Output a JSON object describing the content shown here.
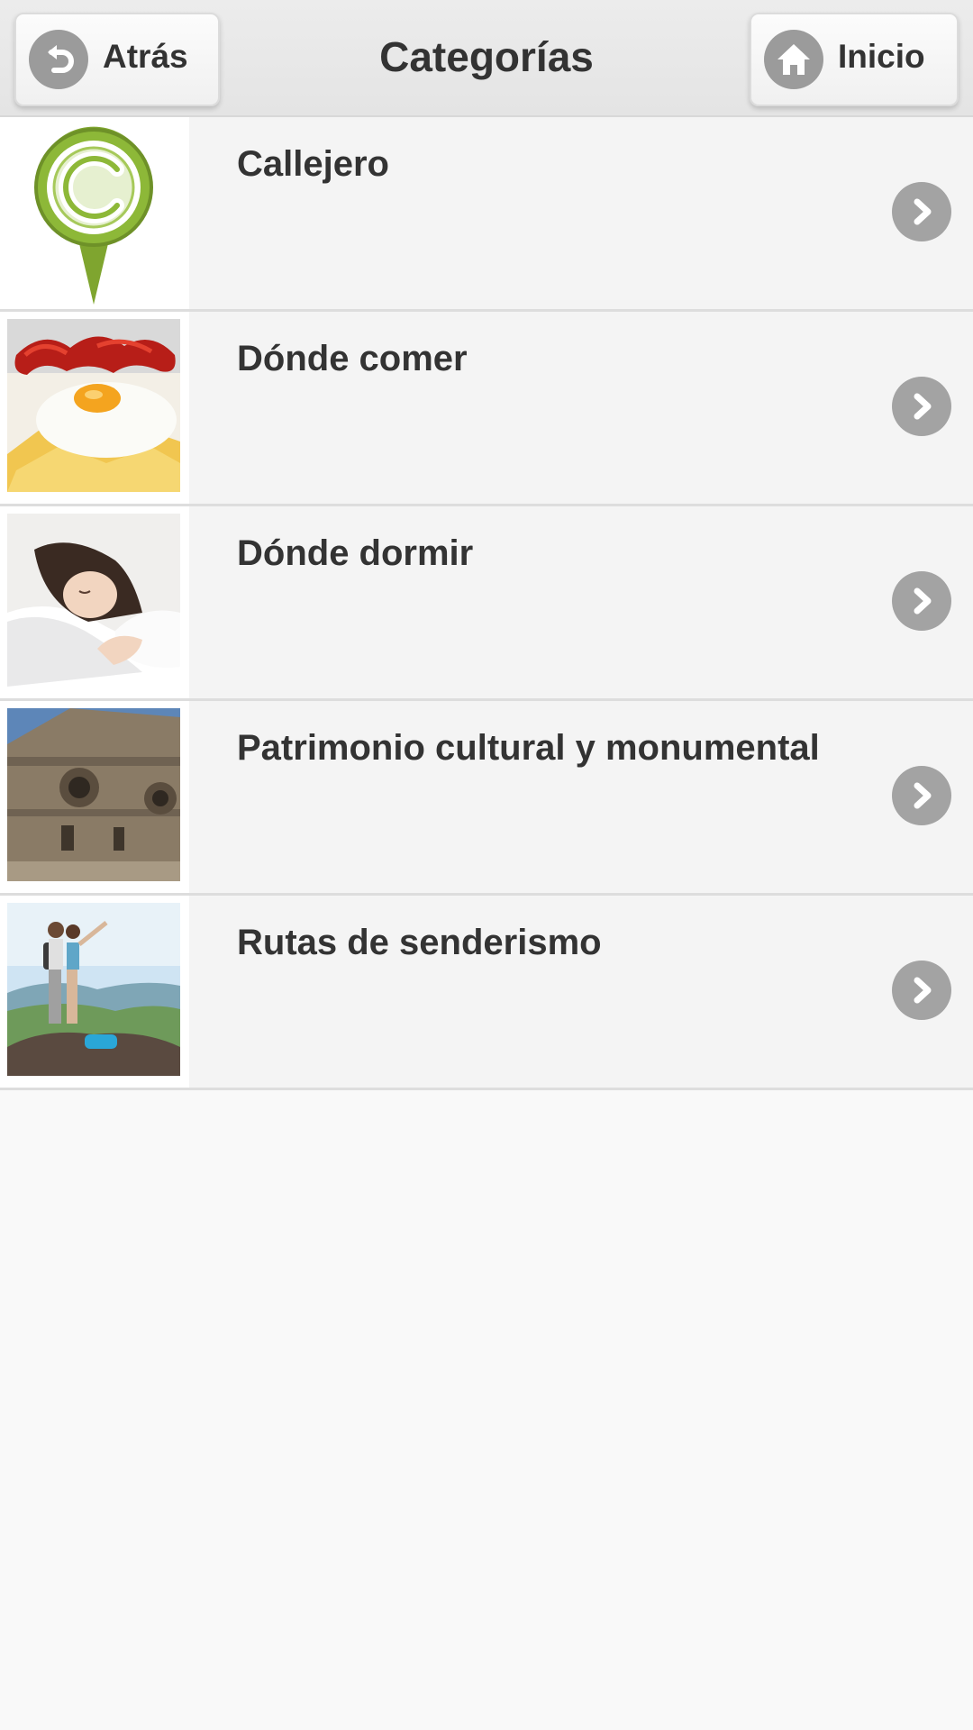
{
  "header": {
    "title": "Categorías",
    "back_label": "Atrás",
    "home_label": "Inicio",
    "back_icon": "undo-arrow-icon",
    "home_icon": "house-icon"
  },
  "categories": [
    {
      "label": "Callejero",
      "thumb": "callejero-map-pin-logo"
    },
    {
      "label": "Dónde comer",
      "thumb": "fried-egg-chorizo-photo"
    },
    {
      "label": "Dónde dormir",
      "thumb": "sleeping-woman-photo"
    },
    {
      "label": "Patrimonio cultural y monumental",
      "thumb": "stone-tower-photo"
    },
    {
      "label": "Rutas de senderismo",
      "thumb": "hikers-on-summit-photo"
    }
  ],
  "colors": {
    "header_bg": "#e8e8e8",
    "icon_gray": "#9b9b9b",
    "text": "#333333",
    "logo_green": "#7fa52f"
  }
}
